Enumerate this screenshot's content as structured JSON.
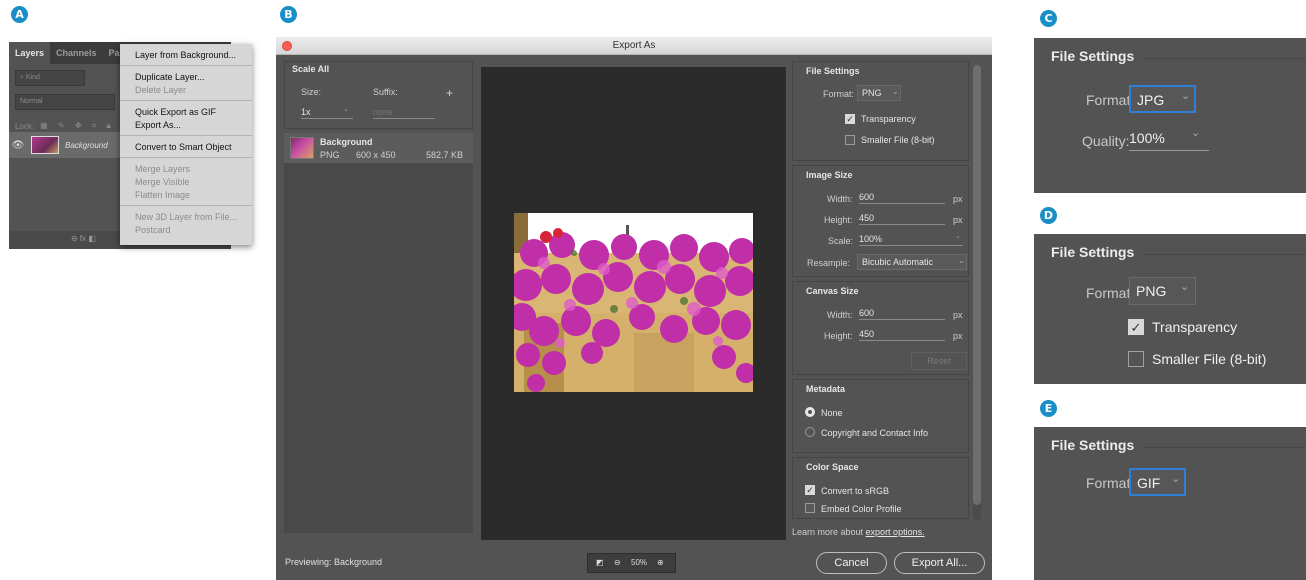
{
  "badges": {
    "a": "A",
    "b": "B",
    "c": "C",
    "d": "D",
    "e": "E"
  },
  "panelA": {
    "tabs": [
      "Layers",
      "Channels",
      "Pa"
    ],
    "kind_placeholder": "Kind",
    "blend_mode": "Normal",
    "lock_label": "Lock:",
    "layer_name": "Background",
    "bottom_icons": "⊖  fx  ◧"
  },
  "menuA": {
    "items": [
      "Layer from Background...",
      "Duplicate Layer...",
      "Delete Layer",
      "Quick Export as GIF",
      "Export As...",
      "Convert to Smart Object",
      "Merge Layers",
      "Merge Visible",
      "Flatten Image",
      "New 3D Layer from File...",
      "Postcard"
    ]
  },
  "dialog": {
    "title": "Export As",
    "scale_all": {
      "title": "Scale All",
      "size_label": "Size:",
      "suffix_label": "Suffix:",
      "size_value": "1x",
      "suffix_placeholder": "none",
      "add": "+"
    },
    "asset": {
      "name": "Background",
      "format": "PNG",
      "dimensions": "600 x 450",
      "filesize": "582.7 KB"
    },
    "file_settings": {
      "title": "File Settings",
      "format_label": "Format:",
      "format_value": "PNG",
      "transparency_label": "Transparency",
      "smaller_file_label": "Smaller File (8-bit)",
      "transparency_checked": true,
      "smaller_file_checked": false
    },
    "image_size": {
      "title": "Image Size",
      "width_label": "Width:",
      "width": "600",
      "height_label": "Height:",
      "height": "450",
      "scale_label": "Scale:",
      "scale": "100%",
      "resample_label": "Resample:",
      "resample": "Bicubic Automatic",
      "unit": "px"
    },
    "canvas_size": {
      "title": "Canvas Size",
      "width_label": "Width:",
      "width": "600",
      "height_label": "Height:",
      "height": "450",
      "unit": "px",
      "reset": "Reset"
    },
    "metadata": {
      "title": "Metadata",
      "none_label": "None",
      "copyright_label": "Copyright and Contact Info",
      "selected": "None"
    },
    "color_space": {
      "title": "Color Space",
      "convert_label": "Convert to sRGB",
      "embed_label": "Embed Color Profile",
      "convert_checked": true,
      "embed_checked": false
    },
    "learn_more_prefix": "Learn more about ",
    "learn_more_link": "export options.",
    "previewing": "Previewing: Background",
    "zoom": "50%",
    "cancel": "Cancel",
    "export_all": "Export All..."
  },
  "panelC": {
    "title": "File Settings",
    "format_label": "Format:",
    "format_value": "JPG",
    "quality_label": "Quality:",
    "quality_value": "100%"
  },
  "panelD": {
    "title": "File Settings",
    "format_label": "Format:",
    "format_value": "PNG",
    "transparency_label": "Transparency",
    "smaller_file_label": "Smaller File (8-bit)",
    "transparency_checked": true,
    "smaller_file_checked": false
  },
  "panelE": {
    "title": "File Settings",
    "format_label": "Format:",
    "format_value": "GIF"
  },
  "colors": {
    "accent": "#1a8fc7",
    "focus": "#2f7fd6",
    "panel_bg": "#535353",
    "close": "#fc5f57"
  }
}
